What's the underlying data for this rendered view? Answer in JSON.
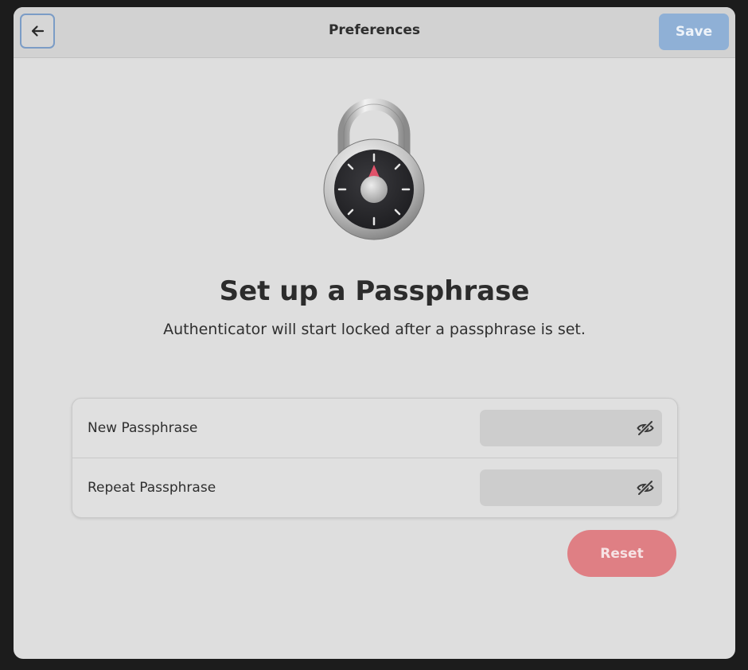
{
  "header": {
    "title": "Preferences",
    "back_icon": "arrow-left-icon",
    "save_label": "Save"
  },
  "main": {
    "illustration_icon": "padlock-icon",
    "heading": "Set up a Passphrase",
    "subtitle": "Authenticator will start locked after a passphrase is set."
  },
  "form": {
    "rows": [
      {
        "label": "New Passphrase",
        "value": "",
        "placeholder": "",
        "toggle_icon": "eye-hidden-icon"
      },
      {
        "label": "Repeat Passphrase",
        "value": "",
        "placeholder": "",
        "toggle_icon": "eye-hidden-icon"
      }
    ],
    "reset_label": "Reset"
  },
  "colors": {
    "accent": "#8fb0d6",
    "destructive": "#df7f84",
    "background": "#dedede",
    "headerbar": "#d2d2d2"
  }
}
